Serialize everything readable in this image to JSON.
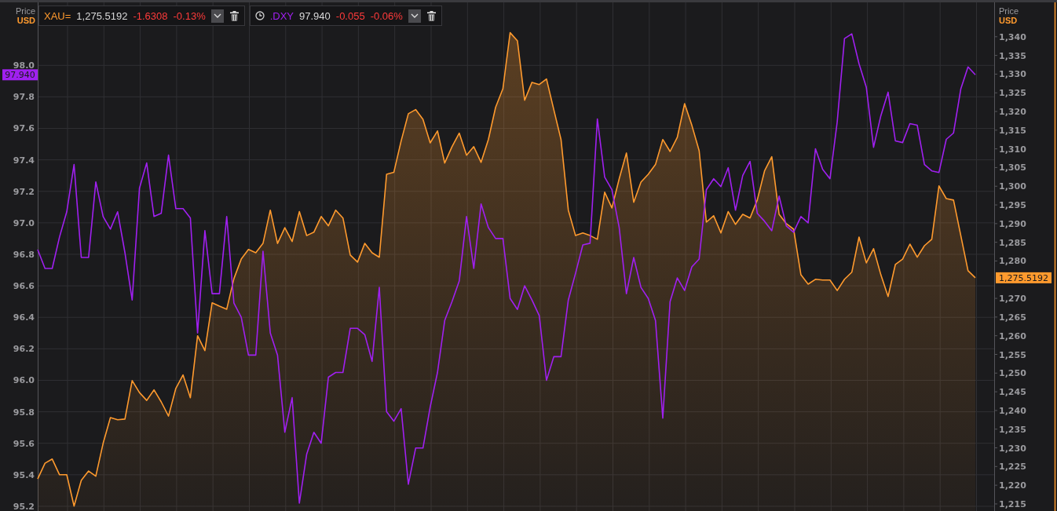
{
  "left_axis": {
    "label": "Price",
    "unit": "USD"
  },
  "right_axis": {
    "label": "Price",
    "unit": "USD"
  },
  "tickers": [
    {
      "clock": false,
      "last": "1,275.5192",
      "change": "-1.6308",
      "change_pct": "-0.13%"
    },
    {
      "clock": true,
      "last": "97.940",
      "change": "-0.055",
      "change_pct": "-0.06%"
    }
  ],
  "chart": {
    "series_styles": [
      {
        "tag": "1,275.5192"
      },
      {
        "tag": "97.940"
      }
    ],
    "chart_data": {
      "type": "area",
      "grid": true,
      "ylim": [
        95.17,
        98.4
      ],
      "y2lim": [
        1213.1,
        1349.2
      ],
      "yticks": [
        {
          "value": 95.2,
          "label": "95.2"
        },
        {
          "value": 95.4,
          "label": "95.4"
        },
        {
          "value": 95.6,
          "label": "95.6"
        },
        {
          "value": 95.8,
          "label": "95.8"
        },
        {
          "value": 96.0,
          "label": "96.0"
        },
        {
          "value": 96.2,
          "label": "96.2"
        },
        {
          "value": 96.4,
          "label": "96.4"
        },
        {
          "value": 96.6,
          "label": "96.6"
        },
        {
          "value": 96.8,
          "label": "96.8"
        },
        {
          "value": 97.0,
          "label": "97.0"
        },
        {
          "value": 97.2,
          "label": "97.2"
        },
        {
          "value": 97.4,
          "label": "97.4"
        },
        {
          "value": 97.6,
          "label": "97.6"
        },
        {
          "value": 97.8,
          "label": "97.8"
        },
        {
          "value": 98.0,
          "label": "98.0"
        }
      ],
      "y2ticks": [
        {
          "value": 1215,
          "label": "1,215"
        },
        {
          "value": 1220,
          "label": "1,220"
        },
        {
          "value": 1225,
          "label": "1,225"
        },
        {
          "value": 1230,
          "label": "1,230"
        },
        {
          "value": 1235,
          "label": "1,235"
        },
        {
          "value": 1240,
          "label": "1,240"
        },
        {
          "value": 1245,
          "label": "1,245"
        },
        {
          "value": 1250,
          "label": "1,250"
        },
        {
          "value": 1255,
          "label": "1,255"
        },
        {
          "value": 1260,
          "label": "1,260"
        },
        {
          "value": 1265,
          "label": "1,265"
        },
        {
          "value": 1270,
          "label": "1,270"
        },
        {
          "value": 1280,
          "label": "1,280"
        },
        {
          "value": 1285,
          "label": "1,285"
        },
        {
          "value": 1290,
          "label": "1,290"
        },
        {
          "value": 1295,
          "label": "1,295"
        },
        {
          "value": 1300,
          "label": "1,300"
        },
        {
          "value": 1305,
          "label": "1,305"
        },
        {
          "value": 1310,
          "label": "1,310"
        },
        {
          "value": 1315,
          "label": "1,315"
        },
        {
          "value": 1320,
          "label": "1,320"
        },
        {
          "value": 1325,
          "label": "1,325"
        },
        {
          "value": 1330,
          "label": "1,330"
        },
        {
          "value": 1335,
          "label": "1,335"
        },
        {
          "value": 1340,
          "label": "1,340"
        }
      ],
      "series": [
        {
          "name": "XAU=",
          "color": "#ff9a2e",
          "axis": "y2",
          "values": [
            1221.7,
            1225.9,
            1227.0,
            1222.8,
            1222.8,
            1214.4,
            1221.3,
            1223.8,
            1222.4,
            1231.2,
            1238.1,
            1237.5,
            1237.7,
            1248.0,
            1244.8,
            1242.7,
            1245.5,
            1242.3,
            1238.5,
            1245.9,
            1249.5,
            1243.4,
            1260.0,
            1256.0,
            1268.8,
            1267.9,
            1267.1,
            1275.3,
            1280.5,
            1283.1,
            1282.2,
            1284.7,
            1293.6,
            1284.7,
            1288.9,
            1285.2,
            1293.2,
            1286.8,
            1287.7,
            1291.9,
            1289.4,
            1293.6,
            1291.5,
            1281.6,
            1279.7,
            1284.7,
            1282.2,
            1281.0,
            1303.2,
            1303.7,
            1312.1,
            1319.4,
            1320.5,
            1317.9,
            1311.6,
            1314.8,
            1306.2,
            1310.6,
            1314.2,
            1308.3,
            1310.6,
            1306.4,
            1312.5,
            1321.1,
            1326.1,
            1341.1,
            1338.9,
            1323.0,
            1327.8,
            1327.2,
            1328.7,
            1320.5,
            1312.5,
            1293.6,
            1286.8,
            1287.5,
            1286.8,
            1285.8,
            1298.4,
            1294.2,
            1302.0,
            1308.9,
            1295.7,
            1301.1,
            1303.2,
            1305.8,
            1312.5,
            1309.3,
            1313.1,
            1322.1,
            1316.3,
            1309.5,
            1290.4,
            1292.1,
            1287.5,
            1293.2,
            1289.8,
            1292.5,
            1291.5,
            1296.3,
            1304.1,
            1307.9,
            1292.5,
            1290.0,
            1288.5,
            1276.3,
            1273.8,
            1275.1,
            1274.9,
            1274.9,
            1272.1,
            1275.1,
            1277.0,
            1286.4,
            1279.5,
            1283.3,
            1276.3,
            1270.5,
            1279.1,
            1280.5,
            1284.5,
            1281.0,
            1284.1,
            1285.8,
            1300.1,
            1296.7,
            1296.3,
            1286.8,
            1277.4,
            1275.5
          ]
        },
        {
          "name": ".DXY",
          "color": "#a020f0",
          "type": "line",
          "values": [
            96.83,
            96.71,
            96.71,
            96.91,
            97.07,
            97.37,
            96.78,
            96.78,
            97.26,
            97.04,
            96.96,
            97.07,
            96.81,
            96.51,
            97.22,
            97.38,
            97.04,
            97.06,
            97.43,
            97.09,
            97.09,
            97.03,
            96.3,
            96.95,
            96.55,
            96.55,
            97.04,
            96.49,
            96.4,
            96.16,
            96.16,
            96.82,
            96.3,
            96.16,
            95.67,
            95.89,
            95.22,
            95.53,
            95.67,
            95.6,
            96.02,
            96.05,
            96.05,
            96.33,
            96.33,
            96.29,
            96.12,
            96.59,
            95.8,
            95.74,
            95.82,
            95.34,
            95.57,
            95.57,
            95.83,
            96.05,
            96.38,
            96.5,
            96.63,
            97.04,
            96.71,
            97.12,
            96.97,
            96.9,
            96.9,
            96.52,
            96.45,
            96.6,
            96.51,
            96.41,
            96.0,
            96.15,
            96.15,
            96.51,
            96.68,
            96.86,
            96.87,
            97.66,
            97.29,
            97.21,
            96.97,
            96.55,
            96.78,
            96.59,
            96.52,
            96.38,
            95.76,
            96.5,
            96.65,
            96.57,
            96.72,
            96.77,
            97.21,
            97.28,
            97.23,
            97.35,
            97.08,
            97.3,
            97.39,
            97.06,
            97.01,
            96.95,
            97.17,
            96.98,
            96.94,
            97.04,
            97.0,
            97.47,
            97.34,
            97.28,
            97.64,
            98.17,
            98.2,
            98.01,
            97.86,
            97.48,
            97.68,
            97.83,
            97.52,
            97.51,
            97.63,
            97.62,
            97.37,
            97.33,
            97.32,
            97.53,
            97.57,
            97.85,
            97.99,
            97.94
          ]
        }
      ]
    }
  }
}
